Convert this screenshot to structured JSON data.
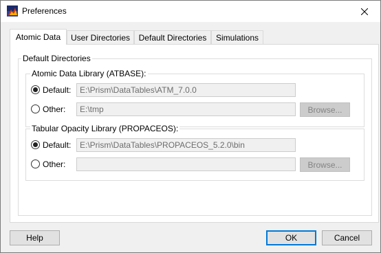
{
  "window": {
    "title": "Preferences",
    "app_icon": "prism-app-icon",
    "close_icon": "close-icon"
  },
  "tabs": [
    {
      "label": "Atomic Data",
      "active": true
    },
    {
      "label": "User Directories",
      "active": false
    },
    {
      "label": "Default Directories",
      "active": false
    },
    {
      "label": "Simulations",
      "active": false
    }
  ],
  "outer_group": {
    "label": "Default Directories"
  },
  "atbase": {
    "label": "Atomic Data Library (ATBASE):",
    "default_label": "Default:",
    "default_value": "E:\\Prism\\DataTables\\ATM_7.0.0",
    "default_selected": true,
    "other_label": "Other:",
    "other_value": "E:\\tmp",
    "browse_label": "Browse..."
  },
  "propaceos": {
    "label": "Tabular Opacity Library (PROPACEOS):",
    "default_label": "Default:",
    "default_value": "E:\\Prism\\DataTables\\PROPACEOS_5.2.0\\bin",
    "default_selected": true,
    "other_label": "Other:",
    "other_value": "",
    "browse_label": "Browse..."
  },
  "footer": {
    "help_label": "Help",
    "ok_label": "OK",
    "cancel_label": "Cancel"
  },
  "colors": {
    "accent": "#0078d7",
    "window_bg": "#f0f0f0",
    "panel_bg": "#ffffff"
  }
}
